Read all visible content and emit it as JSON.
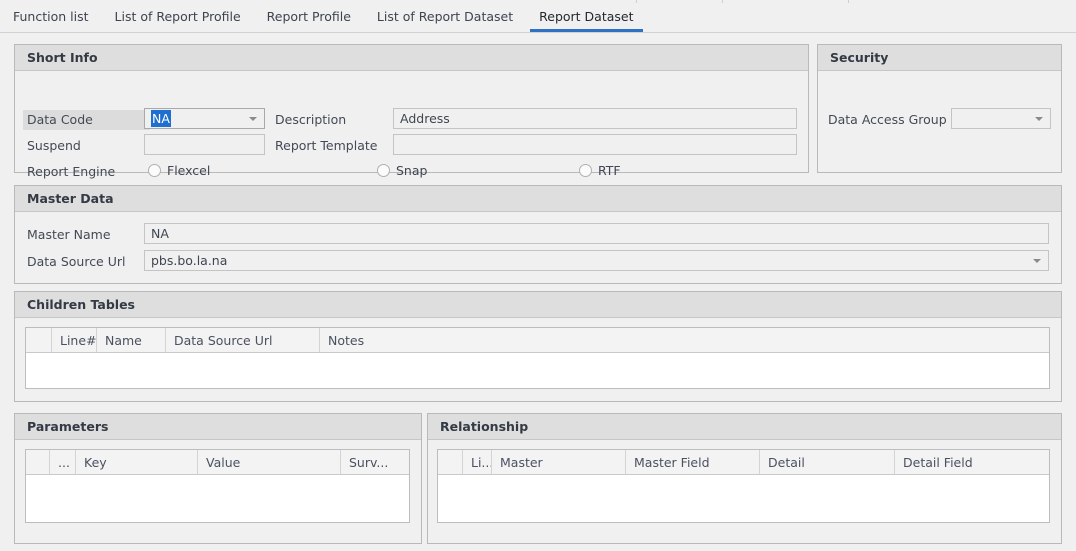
{
  "tabs": [
    {
      "label": "Function list",
      "active": false
    },
    {
      "label": "List of Report Profile",
      "active": false
    },
    {
      "label": "Report Profile",
      "active": false
    },
    {
      "label": "List of Report Dataset",
      "active": false
    },
    {
      "label": "Report Dataset",
      "active": true
    }
  ],
  "colors": {
    "accent": "#2f72c4",
    "selection": "#1f6fd0",
    "panel_header": "#dedede",
    "page_bg": "#f0f0f0",
    "border": "#b9b9b9"
  },
  "short_info": {
    "title": "Short Info",
    "data_code_label": "Data Code",
    "data_code_value": "NA",
    "description_label": "Description",
    "description_value": "Address",
    "suspend_label": "Suspend",
    "suspend_value": "",
    "report_template_label": "Report Template",
    "report_template_value": "",
    "report_engine_label": "Report Engine",
    "report_engine_options": [
      {
        "label": "Flexcel",
        "checked": false
      },
      {
        "label": "Snap",
        "checked": false
      },
      {
        "label": "RTF",
        "checked": false
      }
    ]
  },
  "security": {
    "title": "Security",
    "data_access_group_label": "Data Access Group",
    "data_access_group_value": ""
  },
  "master_data": {
    "title": "Master Data",
    "master_name_label": "Master Name",
    "master_name_value": "NA",
    "data_source_url_label": "Data Source Url",
    "data_source_url_value": "pbs.bo.la.na"
  },
  "children_tables": {
    "title": "Children Tables",
    "columns": [
      "",
      "Line#",
      "Name",
      "Data Source Url",
      "Notes"
    ],
    "rows": []
  },
  "parameters": {
    "title": "Parameters",
    "columns": [
      "",
      "...",
      "Key",
      "Value",
      "Surv..."
    ],
    "rows": []
  },
  "relationship": {
    "title": "Relationship",
    "columns": [
      "",
      "Li...",
      "Master",
      "Master Field",
      "Detail",
      "Detail Field"
    ],
    "rows": []
  }
}
